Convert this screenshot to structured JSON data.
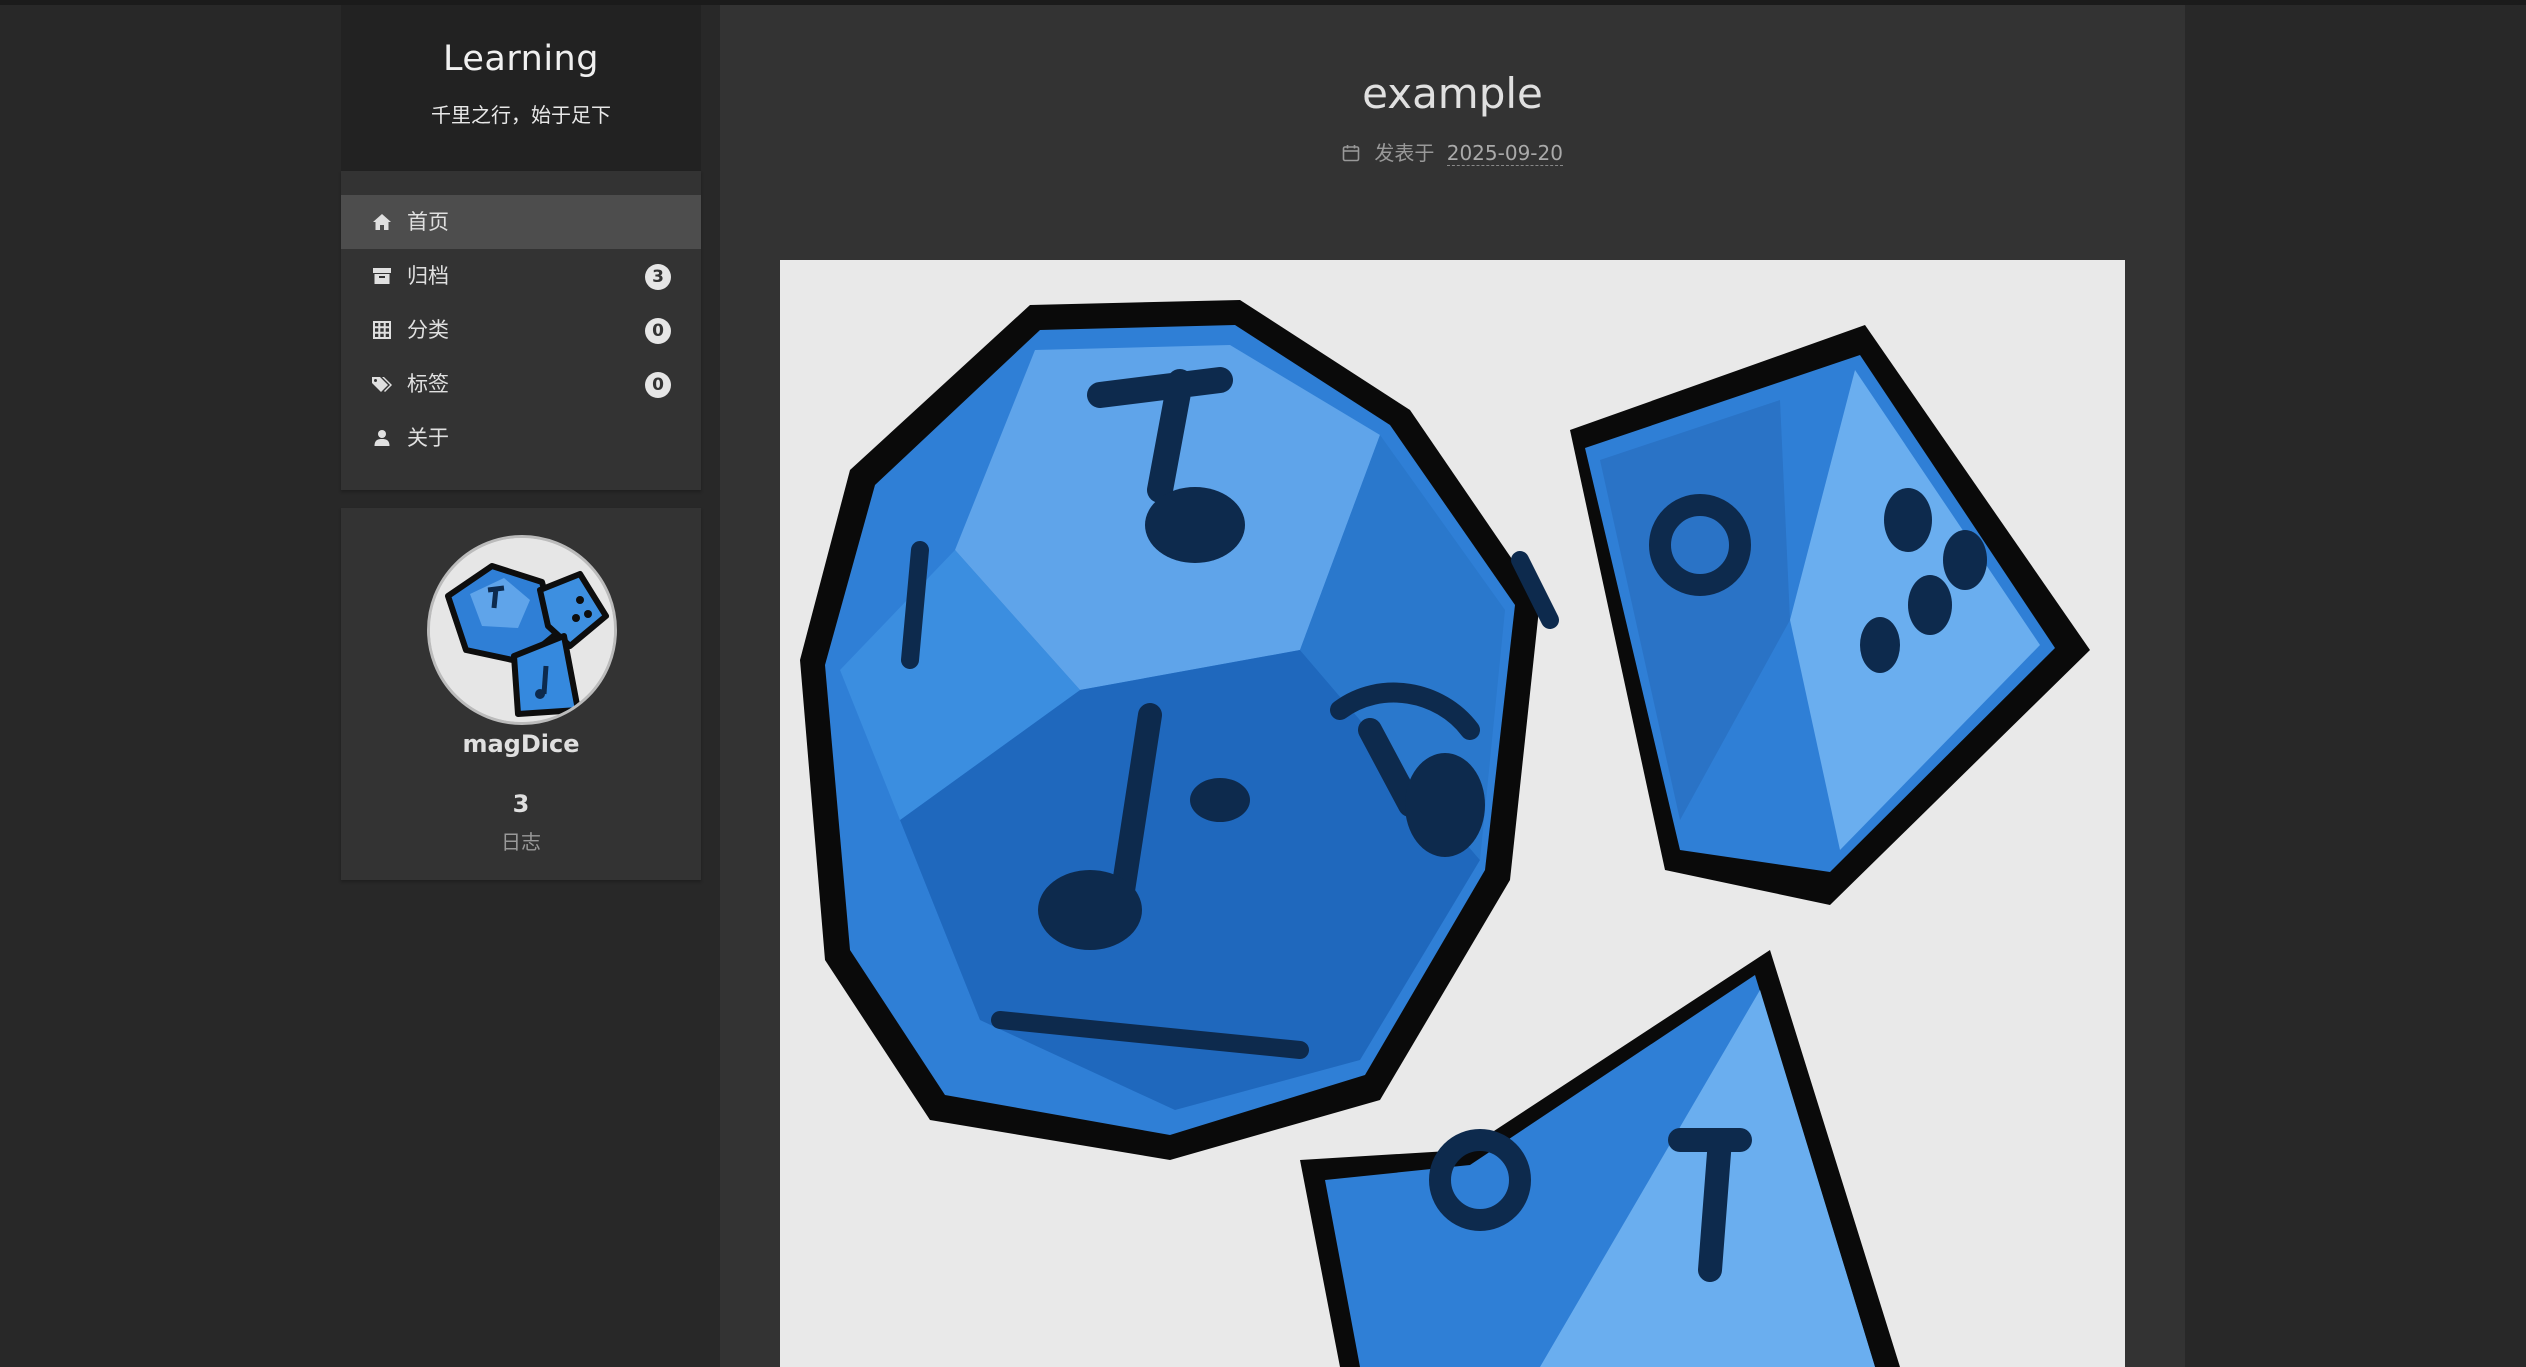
{
  "site": {
    "title": "Learning",
    "subtitle": "千里之行，始于足下"
  },
  "menu": {
    "items": [
      {
        "label": "首页",
        "icon": "home-icon",
        "badge": null,
        "active": true
      },
      {
        "label": "归档",
        "icon": "archive-icon",
        "badge": "3",
        "active": false
      },
      {
        "label": "分类",
        "icon": "grid-icon",
        "badge": "0",
        "active": false
      },
      {
        "label": "标签",
        "icon": "tags-icon",
        "badge": "0",
        "active": false
      },
      {
        "label": "关于",
        "icon": "user-icon",
        "badge": null,
        "active": false
      }
    ]
  },
  "author": {
    "name": "magDice",
    "avatar_icon": "dice-avatar",
    "posts_count": "3",
    "posts_label": "日志"
  },
  "post": {
    "title": "example",
    "meta_prefix": "发表于",
    "date": "2025-09-20",
    "image": "blue-dice-illustration"
  },
  "colors": {
    "page_bg": "#282828",
    "panel_bg": "#333333",
    "brand_bg": "#222222",
    "active_item_bg": "#4d4d4d",
    "dice_blue": "#2f7fd6"
  }
}
